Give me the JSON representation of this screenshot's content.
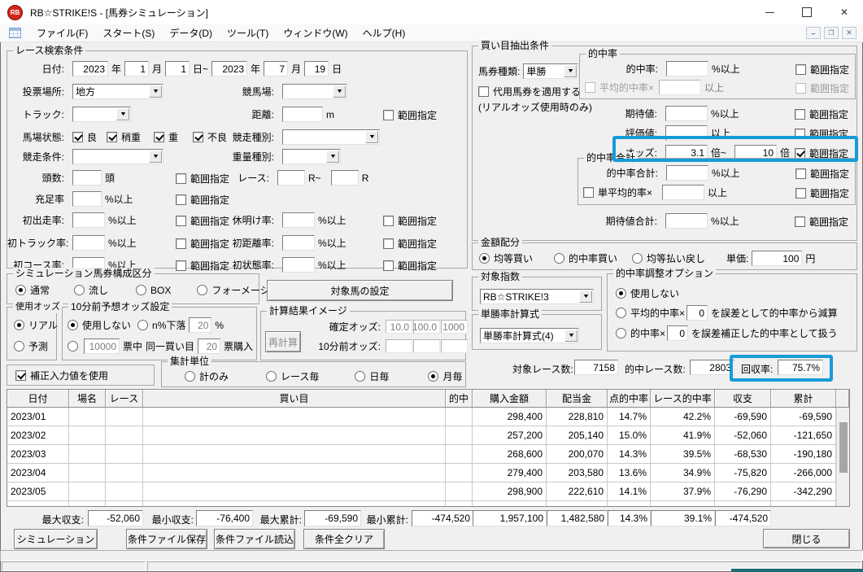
{
  "window": {
    "title": "RB☆STRIKE!S - [馬券シミュレーション]",
    "icon_text": "RB"
  },
  "menu": {
    "items": [
      "ファイル(F)",
      "スタート(S)",
      "データ(D)",
      "ツール(T)",
      "ウィンドウ(W)",
      "ヘルプ(H)"
    ]
  },
  "labels": {
    "range": "範囲指定",
    "pct_min": "%以上",
    "min": "以上",
    "year": "年",
    "month": "月",
    "day": "日",
    "day_to": "日~",
    "m": "m",
    "head": "頭",
    "r_from": "R~",
    "r": "R",
    "times_from": "倍~",
    "times": "倍",
    "yen": "円",
    "pct": "%"
  },
  "race_search": {
    "title": "レース検索条件",
    "date_label": "日付:",
    "y1": "2023",
    "m1": "1",
    "d1": "1",
    "y2": "2023",
    "m2": "7",
    "d2": "19",
    "place_label": "投票場所:",
    "place": "地方",
    "course_label": "競馬場:",
    "course": "",
    "track_label": "トラック:",
    "track": "",
    "dist_label": "距離:",
    "dist": "",
    "baba_label": "馬場状態:",
    "baba": [
      {
        "label": "良",
        "on": true
      },
      {
        "label": "稍重",
        "on": true
      },
      {
        "label": "重",
        "on": true
      },
      {
        "label": "不良",
        "on": true
      }
    ],
    "type_label": "競走種別:",
    "type": "",
    "cond_label": "競走条件:",
    "cond": "",
    "weight_label": "重量種別:",
    "weight": "",
    "heads_label": "頭数:",
    "heads": "",
    "race_label": "レース:",
    "race_from": "",
    "race_to": "",
    "fill_label": "充足率",
    "fill": "",
    "first_run_label": "初出走率:",
    "first_run": "",
    "rest_label": "休明け率:",
    "rest": "",
    "first_track_label": "初トラック率:",
    "first_track": "",
    "first_dist_label": "初距離率:",
    "first_dist": "",
    "first_course_label": "初コース率:",
    "first_course": "",
    "first_cond_label": "初状態率:",
    "first_cond": ""
  },
  "sim_type": {
    "title": "シミュレーション馬券構成区分",
    "options": [
      {
        "label": "通常",
        "on": true
      },
      {
        "label": "流し",
        "on": false
      },
      {
        "label": "BOX",
        "on": false
      },
      {
        "label": "フォーメーション",
        "on": false
      }
    ]
  },
  "target_btn": "対象馬の設定",
  "use_odds": {
    "title": "使用オッズ",
    "options": [
      {
        "label": "リアル",
        "on": true
      },
      {
        "label": "予測",
        "on": false
      }
    ]
  },
  "pre_odds": {
    "title": "10分前予想オッズ設定",
    "none": {
      "label": "使用しない",
      "on": true
    },
    "drop": {
      "label": "n%下落",
      "on": false,
      "value": "20"
    },
    "votes": {
      "on": false,
      "value": "10000",
      "mid1": "票中",
      "mid2": "同一買い目",
      "buy": "20",
      "suffix": "票購入"
    }
  },
  "calc_img": {
    "title": "計算結果イメージ",
    "recalc": "再計算",
    "fixed_label": "確定オッズ:",
    "fixed": [
      "10.0",
      "100.0",
      "1000"
    ],
    "pre_label": "10分前オッズ:",
    "pre": [
      "",
      "",
      ""
    ]
  },
  "hosei": {
    "label": "補正入力値を使用",
    "on": true
  },
  "agg_unit": {
    "title": "集計単位",
    "options": [
      {
        "label": "計のみ",
        "on": false
      },
      {
        "label": "レース毎",
        "on": false
      },
      {
        "label": "日毎",
        "on": false
      },
      {
        "label": "月毎",
        "on": true
      }
    ]
  },
  "extract": {
    "title": "買い目抽出条件",
    "ticket_label": "馬券種類:",
    "ticket": "単勝",
    "daiyo": {
      "label": "代用馬券を適用する",
      "on": false
    },
    "daiyo_note": "(リアルオッズ使用時のみ)",
    "hit_box": "的中率",
    "hit_label": "的中率:",
    "hit": "",
    "avg_hit": {
      "label": "平均的中率×",
      "on": false,
      "value": ""
    },
    "expect_label": "期待値:",
    "expect": "",
    "eval_label": "評価値:",
    "eval": "",
    "odds_label": "オッズ:",
    "odds_from": "3.1",
    "odds_to": "10",
    "odds_range_on": true,
    "hitsum_box": "的中率合計",
    "hitsum_label": "的中率合計:",
    "hitsum": "",
    "single_avg": {
      "label": "単平均的率×",
      "on": false,
      "value": ""
    },
    "expsum_label": "期待値合計:",
    "expsum": ""
  },
  "amount": {
    "title": "金額配分",
    "options": [
      {
        "label": "均等買い",
        "on": true
      },
      {
        "label": "的中率買い",
        "on": false
      },
      {
        "label": "均等払い戻し",
        "on": false
      }
    ],
    "unit_label": "単価:",
    "unit": "100"
  },
  "index_box": {
    "title": "対象指数",
    "value": "RB☆STRIKE!3"
  },
  "formula_box": {
    "title": "単勝率計算式",
    "value": "単勝率計算式(4)"
  },
  "adjust": {
    "title": "的中率調整オプション",
    "o1": {
      "label": "使用しない",
      "on": true
    },
    "o2": {
      "label": "平均的中率×",
      "value": "0",
      "suffix": "を誤差として的中率から減算",
      "on": false
    },
    "o3": {
      "label": "的中率×",
      "value": "0",
      "suffix": "を誤差補正した的中率として扱う",
      "on": false
    }
  },
  "stats": {
    "races_label": "対象レース数:",
    "races": "7158",
    "hits_label": "的中レース数:",
    "hits": "2803",
    "payback_label": "回収率:",
    "payback": "75.7%"
  },
  "table": {
    "headers": [
      "日付",
      "場名",
      "レース",
      "買い目",
      "的中",
      "購入金額",
      "配当金",
      "点的中率",
      "レース的中率",
      "収支",
      "累計"
    ],
    "rows": [
      {
        "date": "2023/01",
        "buy": "298,400",
        "pay": "228,810",
        "prate": "14.7%",
        "rrate": "42.2%",
        "bal": "-69,590",
        "cum": "-69,590"
      },
      {
        "date": "2023/02",
        "buy": "257,200",
        "pay": "205,140",
        "prate": "15.0%",
        "rrate": "41.9%",
        "bal": "-52,060",
        "cum": "-121,650"
      },
      {
        "date": "2023/03",
        "buy": "268,600",
        "pay": "200,070",
        "prate": "14.3%",
        "rrate": "39.5%",
        "bal": "-68,530",
        "cum": "-190,180"
      },
      {
        "date": "2023/04",
        "buy": "279,400",
        "pay": "203,580",
        "prate": "13.6%",
        "rrate": "34.9%",
        "bal": "-75,820",
        "cum": "-266,000"
      },
      {
        "date": "2023/05",
        "buy": "298,900",
        "pay": "222,610",
        "prate": "14.1%",
        "rrate": "37.9%",
        "bal": "-76,290",
        "cum": "-342,290"
      }
    ]
  },
  "summary": {
    "max_bal_label": "最大収支:",
    "max_bal": "-52,060",
    "min_bal_label": "最小収支:",
    "min_bal": "-76,400",
    "max_cum_label": "最大累計:",
    "max_cum": "-69,590",
    "min_cum_label": "最小累計:",
    "min_cum": "-474,520",
    "totals": [
      "1,957,100",
      "1,482,580",
      "14.3%",
      "39.1%",
      "-474,520"
    ]
  },
  "actions": {
    "simulate": "シミュレーション",
    "save": "条件ファイル保存",
    "load": "条件ファイル読込",
    "clear": "条件全クリア",
    "close": "閉じる"
  }
}
